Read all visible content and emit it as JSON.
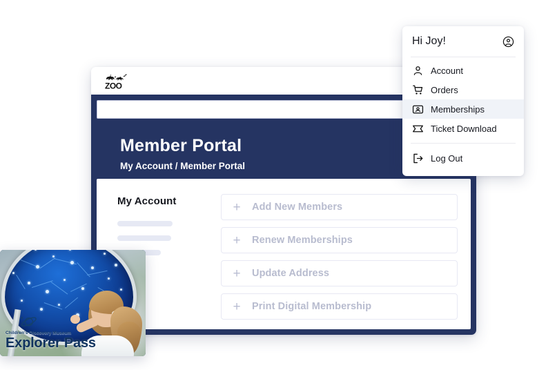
{
  "portal": {
    "logo_alt": "zoo-logo",
    "logo_text": "ZOO",
    "search_value": "",
    "search_placeholder": "",
    "hero_title": "Member Portal",
    "breadcrumb": "My Account / Member Portal",
    "sidebar": {
      "title": "My Account",
      "skeleton_count": 3
    },
    "accordions": [
      {
        "icon": "plus-icon",
        "label": "Add New Members"
      },
      {
        "icon": "plus-icon",
        "label": "Renew Memberships"
      },
      {
        "icon": "plus-icon",
        "label": "Update Address"
      },
      {
        "icon": "plus-icon",
        "label": "Print Digital Membership"
      }
    ],
    "plus_glyph": "+"
  },
  "dropdown": {
    "greeting": "Hi Joy!",
    "avatar_icon": "account-circle-icon",
    "items": [
      {
        "label": "Account",
        "icon": "person-icon",
        "active": false
      },
      {
        "label": "Orders",
        "icon": "shopping-cart-icon",
        "active": false
      },
      {
        "label": "Memberships",
        "icon": "id-card-icon",
        "active": true
      },
      {
        "label": "Ticket Download",
        "icon": "ticket-icon",
        "active": false
      }
    ],
    "footer": {
      "label": "Log Out",
      "icon": "logout-icon"
    }
  },
  "pass_card": {
    "museum_name": "Children's Discovery Museum",
    "title": "Explorer Pass",
    "logo_icon": "planet-icon"
  },
  "colors": {
    "navy": "#253462",
    "accent_blue": "#1e6fd8",
    "muted_label": "#b8bccf",
    "skeleton": "#e6e9f4",
    "menu_highlight": "#f0f3f8"
  }
}
